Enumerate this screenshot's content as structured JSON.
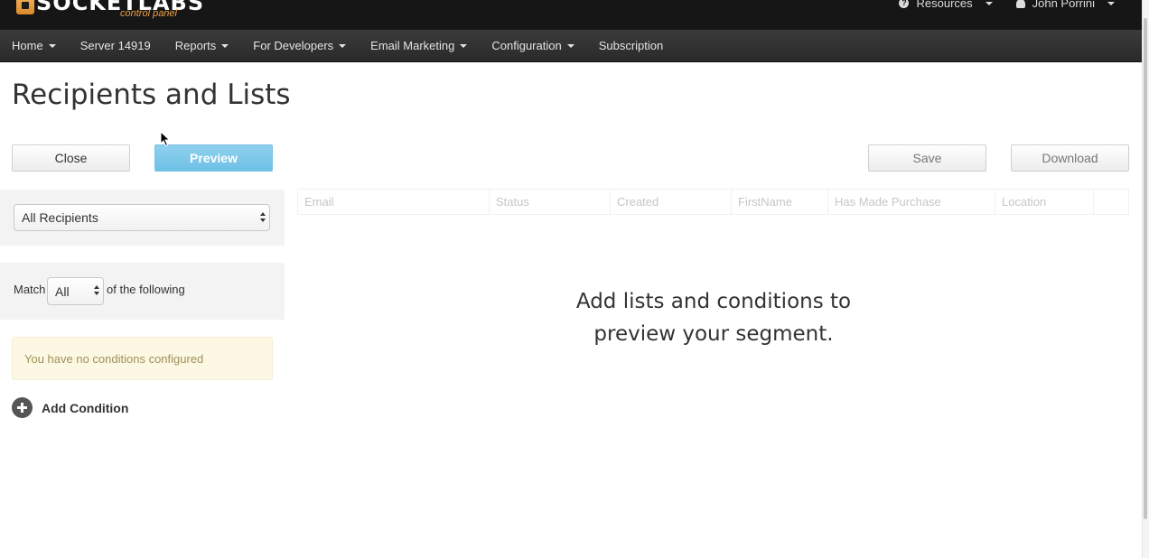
{
  "topbar": {
    "logo_text": "SOCKETLABS",
    "logo_sub": "control panel",
    "resources_label": "Resources",
    "user_label": "John Porrini"
  },
  "nav": {
    "items": [
      {
        "label": "Home",
        "dropdown": true
      },
      {
        "label": "Server 14919",
        "dropdown": false
      },
      {
        "label": "Reports",
        "dropdown": true
      },
      {
        "label": "For Developers",
        "dropdown": true
      },
      {
        "label": "Email Marketing",
        "dropdown": true
      },
      {
        "label": "Configuration",
        "dropdown": true
      },
      {
        "label": "Subscription",
        "dropdown": false
      }
    ]
  },
  "page": {
    "title": "Recipients and Lists"
  },
  "toolbar": {
    "close_label": "Close",
    "preview_label": "Preview",
    "save_label": "Save",
    "download_label": "Download"
  },
  "segment": {
    "recipients_select": "All Recipients",
    "match_label": "Match",
    "match_value": "All",
    "following_label": "of the following",
    "no_conditions": "You have no conditions configured",
    "add_condition_label": "Add Condition"
  },
  "grid": {
    "columns": [
      "Email",
      "Status",
      "Created",
      "FirstName",
      "Has Made Purchase",
      "Location",
      ""
    ],
    "empty_line1": "Add lists and conditions to",
    "empty_line2": "preview your segment."
  },
  "colors": {
    "topbar": "#161616",
    "navbar": "#333333",
    "preview_button": "#7cc7ea",
    "alert_bg": "#fcf8e3"
  }
}
